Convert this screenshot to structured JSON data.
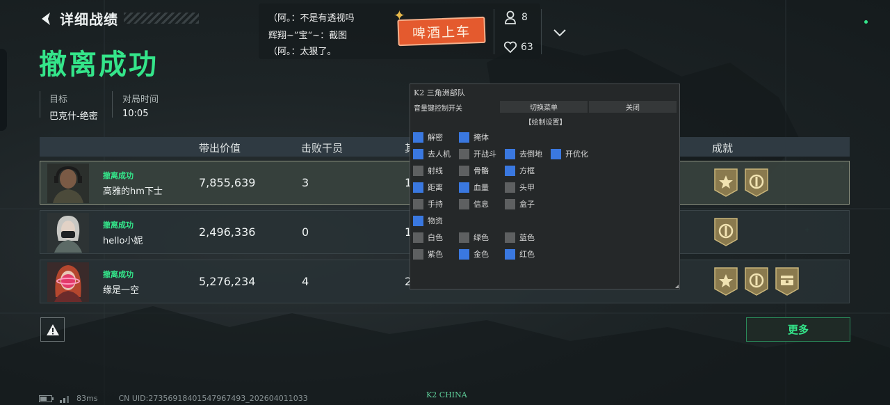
{
  "header": {
    "title": "详细战绩",
    "result": "撤离成功"
  },
  "info": [
    {
      "label": "目标",
      "value": "巴克什-绝密"
    },
    {
      "label": "对局时间",
      "value": "10:05"
    }
  ],
  "table": {
    "columns": [
      "带出价值",
      "击败干员",
      "其",
      "成就"
    ],
    "rows": [
      {
        "status": "撤离成功",
        "name": "高雅的hm下士",
        "value": "7,855,639",
        "kills": "3",
        "extra": "1",
        "medals": [
          "star-medal-icon",
          "shield-medal-icon"
        ]
      },
      {
        "status": "撤离成功",
        "name": "hello小妮",
        "value": "2,496,336",
        "kills": "0",
        "extra": "1",
        "medals": [
          "shield-medal-icon"
        ]
      },
      {
        "status": "撤离成功",
        "name": "缘是一空",
        "value": "5,276,234",
        "kills": "4",
        "extra": "2",
        "medals": [
          "star-medal-icon",
          "shield-medal-icon",
          "chest-medal-icon"
        ]
      }
    ]
  },
  "more_label": "更多",
  "bottom": {
    "ping": "83ms",
    "uid": "CN UID:273569184015479674​93_202604011033"
  },
  "watermark": "K2 CHINA",
  "comments": [
    "（阿。：不是有透视吗",
    "辉翔~”宝“~：截图",
    "（阿。：太狠了。"
  ],
  "sticker": "啤酒上车",
  "counts": {
    "people": "8",
    "likes": "63"
  },
  "menu": {
    "title": "K2 三角洲部队",
    "toggle_label": "音量键控制开关",
    "switch_label": "切换菜单",
    "close_label": "关闭",
    "section": "【绘制设置】",
    "options": [
      [
        {
          "label": "解密",
          "on": true
        },
        {
          "label": "掩体",
          "on": true
        }
      ],
      [
        {
          "label": "去人机",
          "on": true
        },
        {
          "label": "开战斗",
          "on": false
        },
        {
          "label": "去倒地",
          "on": true
        },
        {
          "label": "开优化",
          "on": true
        }
      ],
      [
        {
          "label": "射线",
          "on": false
        },
        {
          "label": "骨骼",
          "on": false
        },
        {
          "label": "方框",
          "on": true
        }
      ],
      [
        {
          "label": "距离",
          "on": true
        },
        {
          "label": "血量",
          "on": true
        },
        {
          "label": "头甲",
          "on": false
        }
      ],
      [
        {
          "label": "手持",
          "on": false
        },
        {
          "label": "信息",
          "on": false
        },
        {
          "label": "盒子",
          "on": false
        }
      ],
      [
        {
          "label": "物资",
          "on": true
        }
      ],
      [
        {
          "label": "白色",
          "on": false
        },
        {
          "label": "绿色",
          "on": false
        },
        {
          "label": "蓝色",
          "on": false
        }
      ],
      [
        {
          "label": "紫色",
          "on": false
        },
        {
          "label": "金色",
          "on": true
        },
        {
          "label": "红色",
          "on": true
        }
      ]
    ]
  },
  "colors": {
    "accent_green": "#34e58a",
    "checkbox_on": "#3a78e0",
    "sticker": "#e45a2e"
  }
}
